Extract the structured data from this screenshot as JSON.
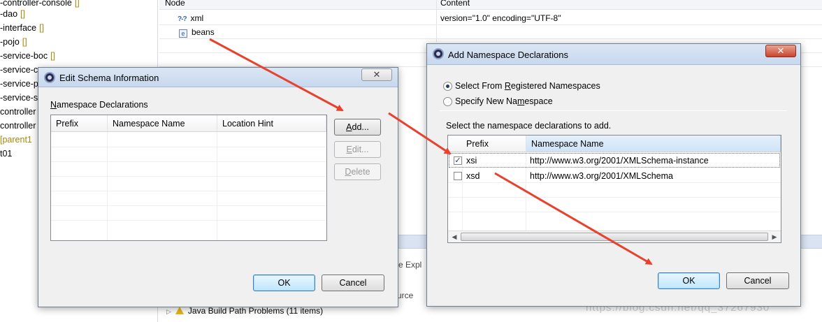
{
  "explorer": {
    "items": [
      {
        "label": "-controller-console",
        "decoration": "[]"
      },
      {
        "label": "-dao",
        "decoration": "[]"
      },
      {
        "label": "-interface",
        "decoration": "[]"
      },
      {
        "label": "-pojo",
        "decoration": "[]"
      },
      {
        "label": "-service-boc",
        "decoration": "[]"
      },
      {
        "label": "-service-c",
        "decoration": ""
      },
      {
        "label": "-service-p",
        "decoration": ""
      },
      {
        "label": "-service-s",
        "decoration": ""
      },
      {
        "label": "controller",
        "decoration": ""
      },
      {
        "label": "controller",
        "decoration": ""
      },
      {
        "label": "",
        "decoration": "[parent1"
      },
      {
        "label": "t01",
        "decoration": ""
      }
    ]
  },
  "design_view": {
    "col_node": "Node",
    "col_content": "Content",
    "rows": [
      {
        "icon": "?-?",
        "node": "xml",
        "content": "version=\"1.0\" encoding=\"UTF-8\""
      },
      {
        "icon": "e",
        "node": "beans",
        "content": ""
      }
    ]
  },
  "background": {
    "source_tab_partial": "ce Expl",
    "source_label_partial": "urce",
    "problem_text": "Java Build Path Problems (11 items)",
    "watermark": "https://blog.csdn.net/qq_37267930"
  },
  "edit_schema_dialog": {
    "title": "Edit Schema Information",
    "close_glyph": "✕",
    "section_label_prefix": "N",
    "section_label_rest": "amespace Declarations",
    "columns": [
      "Prefix",
      "Namespace Name",
      "Location Hint"
    ],
    "add_button": {
      "u": "A",
      "rest": "dd..."
    },
    "edit_button": {
      "u": "E",
      "rest": "dit..."
    },
    "delete_button": {
      "u": "D",
      "rest": "elete"
    },
    "ok_label": "OK",
    "cancel_label": "Cancel"
  },
  "add_ns_dialog": {
    "title": "Add Namespace Declarations",
    "close_glyph": "✕",
    "radio_registered": {
      "pre": "Select From ",
      "u": "R",
      "post": "egistered Namespaces",
      "checked": true
    },
    "radio_new": {
      "pre": "Specify New Na",
      "u": "m",
      "post": "espace",
      "checked": false
    },
    "instruction": "Select the namespace declarations to add.",
    "columns": [
      "Prefix",
      "Namespace Name"
    ],
    "rows": [
      {
        "checked": true,
        "check_glyph": "✓",
        "prefix": "xsi",
        "namespace": "http://www.w3.org/2001/XMLSchema-instance"
      },
      {
        "checked": false,
        "check_glyph": "",
        "prefix": "xsd",
        "namespace": "http://www.w3.org/2001/XMLSchema"
      }
    ],
    "scroll_left": "◀",
    "scroll_right": "▶",
    "ok_label": "OK",
    "cancel_label": "Cancel"
  },
  "colors": {
    "annotation_arrow": "#e8412d",
    "titlebar": "#c7d8ee",
    "selection_header": "#cfe3f6"
  }
}
